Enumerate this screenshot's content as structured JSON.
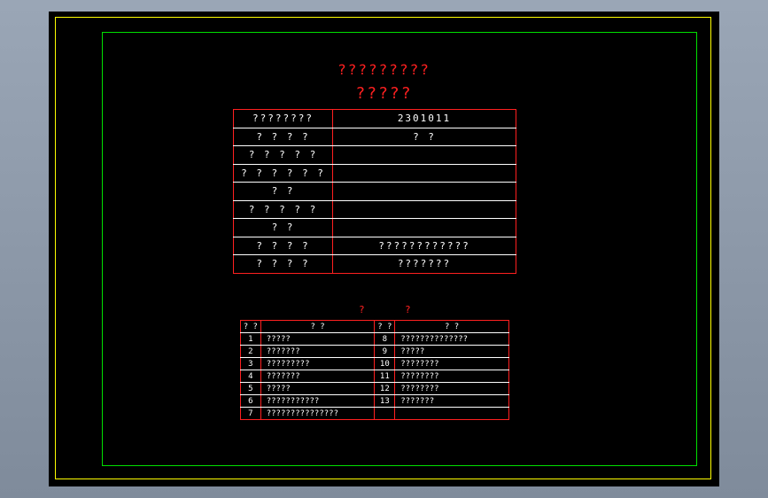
{
  "drawing": {
    "title_line1": "?????????",
    "title_line2": "?????",
    "info_rows": [
      {
        "label": "????????",
        "value": "2301011"
      },
      {
        "label": "? ? ? ?",
        "value": "? ?"
      },
      {
        "label": "? ? ? ? ?",
        "value": ""
      },
      {
        "label": "? ? ? ? ? ?",
        "value": ""
      },
      {
        "label": "? ?",
        "value": ""
      },
      {
        "label": "? ? ? ? ?",
        "value": ""
      },
      {
        "label": "? ?",
        "value": ""
      },
      {
        "label": "? ? ? ?",
        "value": "????????????"
      },
      {
        "label": "? ? ? ?",
        "value": "???????"
      }
    ],
    "list_title": "? ?",
    "list_header": {
      "num1": "? ?",
      "name1": "? ?",
      "num2": "? ?",
      "name2": "? ?"
    },
    "list_rows": [
      {
        "n1": "1",
        "t1": "?????",
        "n2": "8",
        "t2": "??????????????"
      },
      {
        "n1": "2",
        "t1": "???????",
        "n2": "9",
        "t2": "?????"
      },
      {
        "n1": "3",
        "t1": "?????????",
        "n2": "10",
        "t2": "????????"
      },
      {
        "n1": "4",
        "t1": "???????",
        "n2": "11",
        "t2": "????????"
      },
      {
        "n1": "5",
        "t1": "?????",
        "n2": "12",
        "t2": "????????"
      },
      {
        "n1": "6",
        "t1": "???????????",
        "n2": "13",
        "t2": "???????"
      },
      {
        "n1": "7",
        "t1": "???????????????",
        "n2": "",
        "t2": ""
      }
    ]
  },
  "colors": {
    "background": "#000000",
    "outer_frame": "#ffff00",
    "inner_frame": "#00e000",
    "lines": "#ff2020",
    "text": "#ffffff"
  }
}
